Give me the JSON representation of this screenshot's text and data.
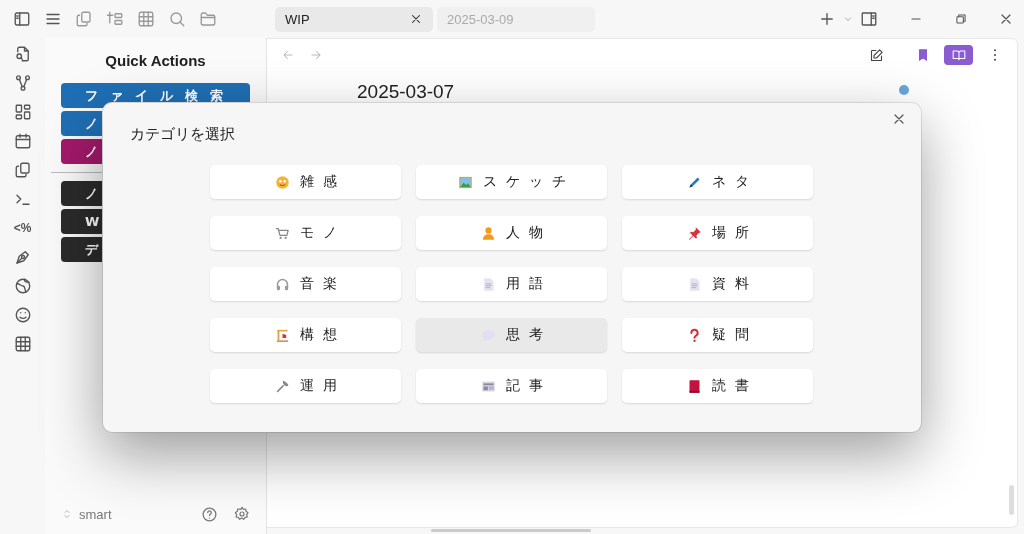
{
  "titlebar": {
    "tabs": [
      {
        "label": "WIP",
        "selected": true
      },
      {
        "label": "2025-03-09",
        "selected": false
      }
    ]
  },
  "ribbon_label": "<%",
  "sidebar": {
    "title": "Quick Actions",
    "groups": [
      [
        {
          "label": "ファイル検索",
          "color": "#1f6fb5"
        },
        {
          "label": "ノ",
          "color": "#1f6fb5"
        },
        {
          "label": "ノ",
          "color": "#a3196b"
        }
      ],
      [
        {
          "label": "ノ",
          "color": "#2b2b2b"
        },
        {
          "label": "W",
          "color": "#2b2b2b"
        },
        {
          "label": "デ",
          "color": "#2b2b2b"
        }
      ]
    ],
    "vault": "smart"
  },
  "note": {
    "title": "2025-03-07",
    "bookmarked": true,
    "reading_view": true
  },
  "modal": {
    "title": "カテゴリを選択",
    "categories": [
      {
        "label": "雑感",
        "selected": false
      },
      {
        "label": "スケッチ",
        "selected": false
      },
      {
        "label": "ネタ",
        "selected": false
      },
      {
        "label": "モノ",
        "selected": false
      },
      {
        "label": "人物",
        "selected": false
      },
      {
        "label": "場所",
        "selected": false
      },
      {
        "label": "音楽",
        "selected": false
      },
      {
        "label": "用語",
        "selected": false
      },
      {
        "label": "資料",
        "selected": false
      },
      {
        "label": "構想",
        "selected": false
      },
      {
        "label": "思考",
        "selected": true
      },
      {
        "label": "疑問",
        "selected": false
      },
      {
        "label": "運用",
        "selected": false
      },
      {
        "label": "記事",
        "selected": false
      },
      {
        "label": "読書",
        "selected": false
      }
    ]
  }
}
